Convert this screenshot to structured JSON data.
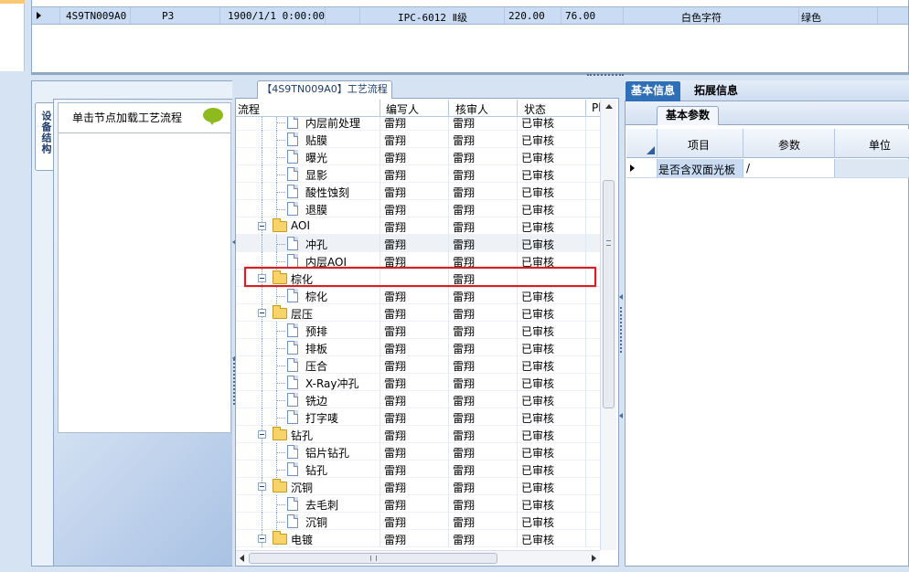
{
  "top_grid": {
    "row": {
      "code": "4S9TN009A0",
      "p": "P3",
      "date": "1900/1/1 0:00:00",
      "standard": "IPC-6012 Ⅱ级",
      "v1": "220.00",
      "v2": "76.00",
      "char_color": "白色字符",
      "color": "绿色"
    }
  },
  "left_panel": {
    "tab_label": "设备结构",
    "header": "单击节点加载工艺流程"
  },
  "middle_panel": {
    "title": "【4S9TN009A0】工艺流程",
    "columns": [
      "流程",
      "编写人",
      "核审人",
      "状态",
      "Pl"
    ],
    "rows": [
      {
        "name": "内层前处理",
        "writer": "雷翔",
        "reviewer": "雷翔",
        "status": "已审核",
        "type": "doc",
        "level": 2
      },
      {
        "name": "贴膜",
        "writer": "雷翔",
        "reviewer": "雷翔",
        "status": "已审核",
        "type": "doc",
        "level": 2
      },
      {
        "name": "曝光",
        "writer": "雷翔",
        "reviewer": "雷翔",
        "status": "已审核",
        "type": "doc",
        "level": 2
      },
      {
        "name": "显影",
        "writer": "雷翔",
        "reviewer": "雷翔",
        "status": "已审核",
        "type": "doc",
        "level": 2
      },
      {
        "name": "酸性蚀刻",
        "writer": "雷翔",
        "reviewer": "雷翔",
        "status": "已审核",
        "type": "doc",
        "level": 2
      },
      {
        "name": "退膜",
        "writer": "雷翔",
        "reviewer": "雷翔",
        "status": "已审核",
        "type": "doc",
        "level": 2
      },
      {
        "name": "AOI",
        "writer": "雷翔",
        "reviewer": "雷翔",
        "status": "已审核",
        "type": "folder",
        "level": 1
      },
      {
        "name": "冲孔",
        "writer": "雷翔",
        "reviewer": "雷翔",
        "status": "已审核",
        "type": "doc",
        "level": 2
      },
      {
        "name": "内层AOI",
        "writer": "雷翔",
        "reviewer": "雷翔",
        "status": "已审核",
        "type": "doc",
        "level": 2
      },
      {
        "name": "棕化",
        "writer": "",
        "reviewer": "雷翔",
        "status": "",
        "type": "folder",
        "level": 1
      },
      {
        "name": "棕化",
        "writer": "雷翔",
        "reviewer": "雷翔",
        "status": "已审核",
        "type": "doc",
        "level": 2
      },
      {
        "name": "层压",
        "writer": "雷翔",
        "reviewer": "雷翔",
        "status": "已审核",
        "type": "folder",
        "level": 1
      },
      {
        "name": "预排",
        "writer": "雷翔",
        "reviewer": "雷翔",
        "status": "已审核",
        "type": "doc",
        "level": 2
      },
      {
        "name": "排板",
        "writer": "雷翔",
        "reviewer": "雷翔",
        "status": "已审核",
        "type": "doc",
        "level": 2
      },
      {
        "name": "压合",
        "writer": "雷翔",
        "reviewer": "雷翔",
        "status": "已审核",
        "type": "doc",
        "level": 2
      },
      {
        "name": "X-Ray冲孔",
        "writer": "雷翔",
        "reviewer": "雷翔",
        "status": "已审核",
        "type": "doc",
        "level": 2
      },
      {
        "name": "铣边",
        "writer": "雷翔",
        "reviewer": "雷翔",
        "status": "已审核",
        "type": "doc",
        "level": 2
      },
      {
        "name": "打字唛",
        "writer": "雷翔",
        "reviewer": "雷翔",
        "status": "已审核",
        "type": "doc",
        "level": 2
      },
      {
        "name": "钻孔",
        "writer": "雷翔",
        "reviewer": "雷翔",
        "status": "已审核",
        "type": "folder",
        "level": 1
      },
      {
        "name": "铝片钻孔",
        "writer": "雷翔",
        "reviewer": "雷翔",
        "status": "已审核",
        "type": "doc",
        "level": 2
      },
      {
        "name": "钻孔",
        "writer": "雷翔",
        "reviewer": "雷翔",
        "status": "已审核",
        "type": "doc",
        "level": 2
      },
      {
        "name": "沉铜",
        "writer": "雷翔",
        "reviewer": "雷翔",
        "status": "已审核",
        "type": "folder",
        "level": 1
      },
      {
        "name": "去毛刺",
        "writer": "雷翔",
        "reviewer": "雷翔",
        "status": "已审核",
        "type": "doc",
        "level": 2
      },
      {
        "name": "沉铜",
        "writer": "雷翔",
        "reviewer": "雷翔",
        "status": "已审核",
        "type": "doc",
        "level": 2
      },
      {
        "name": "电镀",
        "writer": "雷翔",
        "reviewer": "雷翔",
        "status": "已审核",
        "type": "folder",
        "level": 1
      }
    ]
  },
  "right_panel": {
    "tabs": [
      "基本信息",
      "拓展信息"
    ],
    "sub_tab": "基本参数",
    "columns": [
      "项目",
      "参数",
      "单位"
    ],
    "row": {
      "item": "是否含双面光板",
      "param": "/",
      "unit": ""
    }
  },
  "colors": {
    "selection": "#c9dcf4",
    "highlight_box": "#d42020",
    "tab_active": "#2f6fb8"
  }
}
